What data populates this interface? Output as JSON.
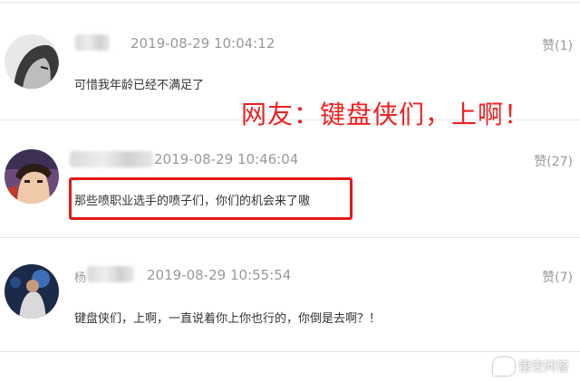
{
  "comments": [
    {
      "username_partial": "",
      "timestamp": "2019-08-29 10:04:12",
      "likes": "赞(1)",
      "text": "可惜我年龄已经不满足了"
    },
    {
      "username_partial": "",
      "timestamp": "2019-08-29 10:46:04",
      "likes": "赞(27)",
      "text": "那些喷职业选手的喷子们，你们的机会来了嗷"
    },
    {
      "username_partial": "杨",
      "timestamp": "2019-08-29 10:55:54",
      "likes": "赞(7)",
      "text": "键盘侠们，上啊，一直说着你上你也行的，你倒是去啊？！"
    }
  ],
  "overlay_caption": "网友：键盘侠们，上啊！",
  "watermark": "悟空问答",
  "colors": {
    "overlay_red": "#ee2020",
    "meta_gray": "#999999",
    "text_dark": "#333333"
  }
}
